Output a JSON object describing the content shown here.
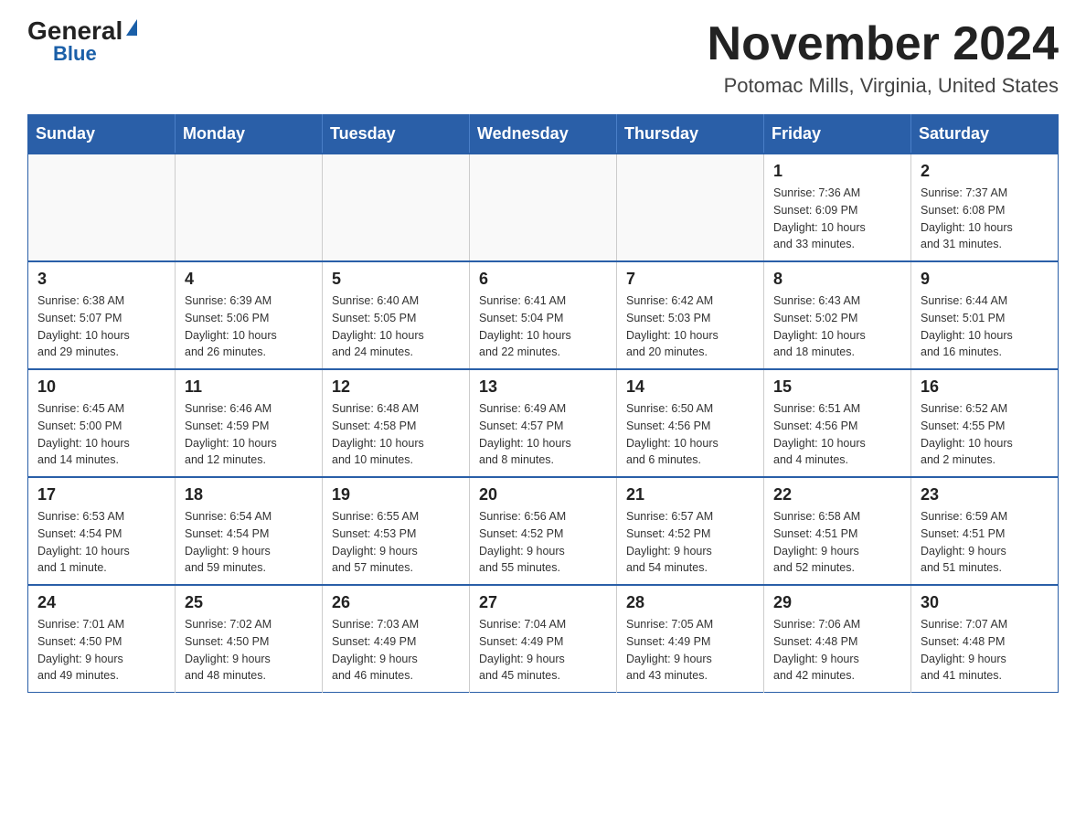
{
  "logo": {
    "general": "General",
    "blue": "Blue"
  },
  "title": "November 2024",
  "location": "Potomac Mills, Virginia, United States",
  "weekdays": [
    "Sunday",
    "Monday",
    "Tuesday",
    "Wednesday",
    "Thursday",
    "Friday",
    "Saturday"
  ],
  "weeks": [
    [
      {
        "day": "",
        "info": ""
      },
      {
        "day": "",
        "info": ""
      },
      {
        "day": "",
        "info": ""
      },
      {
        "day": "",
        "info": ""
      },
      {
        "day": "",
        "info": ""
      },
      {
        "day": "1",
        "info": "Sunrise: 7:36 AM\nSunset: 6:09 PM\nDaylight: 10 hours\nand 33 minutes."
      },
      {
        "day": "2",
        "info": "Sunrise: 7:37 AM\nSunset: 6:08 PM\nDaylight: 10 hours\nand 31 minutes."
      }
    ],
    [
      {
        "day": "3",
        "info": "Sunrise: 6:38 AM\nSunset: 5:07 PM\nDaylight: 10 hours\nand 29 minutes."
      },
      {
        "day": "4",
        "info": "Sunrise: 6:39 AM\nSunset: 5:06 PM\nDaylight: 10 hours\nand 26 minutes."
      },
      {
        "day": "5",
        "info": "Sunrise: 6:40 AM\nSunset: 5:05 PM\nDaylight: 10 hours\nand 24 minutes."
      },
      {
        "day": "6",
        "info": "Sunrise: 6:41 AM\nSunset: 5:04 PM\nDaylight: 10 hours\nand 22 minutes."
      },
      {
        "day": "7",
        "info": "Sunrise: 6:42 AM\nSunset: 5:03 PM\nDaylight: 10 hours\nand 20 minutes."
      },
      {
        "day": "8",
        "info": "Sunrise: 6:43 AM\nSunset: 5:02 PM\nDaylight: 10 hours\nand 18 minutes."
      },
      {
        "day": "9",
        "info": "Sunrise: 6:44 AM\nSunset: 5:01 PM\nDaylight: 10 hours\nand 16 minutes."
      }
    ],
    [
      {
        "day": "10",
        "info": "Sunrise: 6:45 AM\nSunset: 5:00 PM\nDaylight: 10 hours\nand 14 minutes."
      },
      {
        "day": "11",
        "info": "Sunrise: 6:46 AM\nSunset: 4:59 PM\nDaylight: 10 hours\nand 12 minutes."
      },
      {
        "day": "12",
        "info": "Sunrise: 6:48 AM\nSunset: 4:58 PM\nDaylight: 10 hours\nand 10 minutes."
      },
      {
        "day": "13",
        "info": "Sunrise: 6:49 AM\nSunset: 4:57 PM\nDaylight: 10 hours\nand 8 minutes."
      },
      {
        "day": "14",
        "info": "Sunrise: 6:50 AM\nSunset: 4:56 PM\nDaylight: 10 hours\nand 6 minutes."
      },
      {
        "day": "15",
        "info": "Sunrise: 6:51 AM\nSunset: 4:56 PM\nDaylight: 10 hours\nand 4 minutes."
      },
      {
        "day": "16",
        "info": "Sunrise: 6:52 AM\nSunset: 4:55 PM\nDaylight: 10 hours\nand 2 minutes."
      }
    ],
    [
      {
        "day": "17",
        "info": "Sunrise: 6:53 AM\nSunset: 4:54 PM\nDaylight: 10 hours\nand 1 minute."
      },
      {
        "day": "18",
        "info": "Sunrise: 6:54 AM\nSunset: 4:54 PM\nDaylight: 9 hours\nand 59 minutes."
      },
      {
        "day": "19",
        "info": "Sunrise: 6:55 AM\nSunset: 4:53 PM\nDaylight: 9 hours\nand 57 minutes."
      },
      {
        "day": "20",
        "info": "Sunrise: 6:56 AM\nSunset: 4:52 PM\nDaylight: 9 hours\nand 55 minutes."
      },
      {
        "day": "21",
        "info": "Sunrise: 6:57 AM\nSunset: 4:52 PM\nDaylight: 9 hours\nand 54 minutes."
      },
      {
        "day": "22",
        "info": "Sunrise: 6:58 AM\nSunset: 4:51 PM\nDaylight: 9 hours\nand 52 minutes."
      },
      {
        "day": "23",
        "info": "Sunrise: 6:59 AM\nSunset: 4:51 PM\nDaylight: 9 hours\nand 51 minutes."
      }
    ],
    [
      {
        "day": "24",
        "info": "Sunrise: 7:01 AM\nSunset: 4:50 PM\nDaylight: 9 hours\nand 49 minutes."
      },
      {
        "day": "25",
        "info": "Sunrise: 7:02 AM\nSunset: 4:50 PM\nDaylight: 9 hours\nand 48 minutes."
      },
      {
        "day": "26",
        "info": "Sunrise: 7:03 AM\nSunset: 4:49 PM\nDaylight: 9 hours\nand 46 minutes."
      },
      {
        "day": "27",
        "info": "Sunrise: 7:04 AM\nSunset: 4:49 PM\nDaylight: 9 hours\nand 45 minutes."
      },
      {
        "day": "28",
        "info": "Sunrise: 7:05 AM\nSunset: 4:49 PM\nDaylight: 9 hours\nand 43 minutes."
      },
      {
        "day": "29",
        "info": "Sunrise: 7:06 AM\nSunset: 4:48 PM\nDaylight: 9 hours\nand 42 minutes."
      },
      {
        "day": "30",
        "info": "Sunrise: 7:07 AM\nSunset: 4:48 PM\nDaylight: 9 hours\nand 41 minutes."
      }
    ]
  ]
}
